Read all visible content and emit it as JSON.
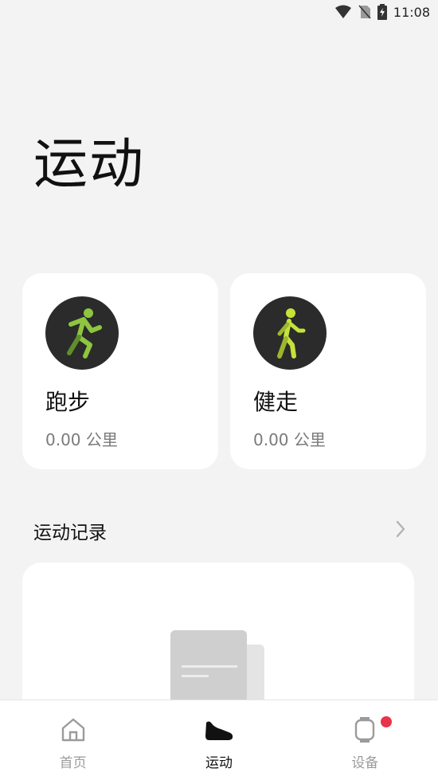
{
  "status_bar": {
    "time": "11:08",
    "icons": [
      "wifi-icon",
      "no-sim-icon",
      "battery-charging-icon"
    ]
  },
  "page": {
    "title": "运动"
  },
  "workouts": [
    {
      "name": "跑步",
      "distance": "0.00 公里",
      "icon": "running-icon",
      "accent": "#8ec63f"
    },
    {
      "name": "健走",
      "distance": "0.00 公里",
      "icon": "walking-icon",
      "accent": "#c6e33a"
    }
  ],
  "records": {
    "title": "运动记录",
    "more_icon": "chevron-right-icon"
  },
  "bottom_nav": {
    "items": [
      {
        "label": "首页",
        "icon": "home-icon",
        "active": false
      },
      {
        "label": "运动",
        "icon": "sneaker-icon",
        "active": true
      },
      {
        "label": "设备",
        "icon": "watch-icon",
        "active": false,
        "notification": true
      }
    ]
  },
  "colors": {
    "background": "#f3f3f3",
    "card": "#ffffff",
    "badge_bg": "#2b2b2b",
    "notification": "#e8344a",
    "secondary_text": "#7a7a7a"
  }
}
